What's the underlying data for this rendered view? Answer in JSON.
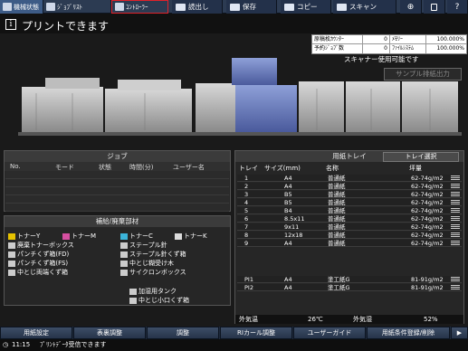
{
  "tabs": [
    {
      "label": "機械状態"
    },
    {
      "label": "ｼﾞｮﾌﾞﾘｽﾄ"
    },
    {
      "label": "ｺﾝﾄﾛｰﾗｰ"
    }
  ],
  "toolbar": {
    "read": "読出し",
    "save": "保存",
    "copy": "コピー",
    "scan": "スキャン"
  },
  "title": "プリントできます",
  "counter": {
    "r1": [
      "原稿枚ｶｳﾝﾀｰ",
      "0",
      "ﾒﾓﾘｰ",
      "100.000%"
    ],
    "r2": [
      "予約ｼﾞｮﾌﾞ数",
      "0",
      "ﾌｧｲﾙｼｽﾃﾑ",
      "100.000%"
    ]
  },
  "scanner_note": "スキャナー使用可能です",
  "sample_button": "サンプル排紙出力",
  "jobs": {
    "title": "ジョブ",
    "columns": [
      "No.",
      "モード",
      "状態",
      "時間(分)",
      "ユーザー名"
    ]
  },
  "supplies": {
    "title": "補給/廃棄部材",
    "items": [
      "トナーY",
      "トナーM",
      "トナーC",
      "トナーK",
      "廃棄トナーボックス",
      "ステープル針",
      "パンチくず箱(FD)",
      "ステープル針くず箱",
      "パンチくず箱(FS)",
      "中とじ糊受け木",
      "中とじ両端くず箱",
      "サイクロンボックス",
      "加湿用タンク",
      "中とじ小口くず箱"
    ]
  },
  "trays": {
    "title": "用紙トレイ",
    "select_button": "トレイ選択",
    "columns": [
      "トレイ",
      "サイズ(mm)",
      "名称",
      "坪量"
    ],
    "rows": [
      [
        "1",
        "A4",
        "普通紙",
        "62-74g/m2"
      ],
      [
        "2",
        "A4",
        "普通紙",
        "62-74g/m2"
      ],
      [
        "3",
        "B5",
        "普通紙",
        "62-74g/m2"
      ],
      [
        "4",
        "B5",
        "普通紙",
        "62-74g/m2"
      ],
      [
        "5",
        "B4",
        "普通紙",
        "62-74g/m2"
      ],
      [
        "6",
        "8.5x11",
        "普通紙",
        "62-74g/m2"
      ],
      [
        "7",
        "9x11",
        "普通紙",
        "62-74g/m2"
      ],
      [
        "8",
        "12x18",
        "普通紙",
        "62-74g/m2"
      ],
      [
        "9",
        "A4",
        "普通紙",
        "62-74g/m2"
      ],
      [
        "PI1",
        "A4",
        "塗工紙G",
        "81-91g/m2"
      ],
      [
        "PI2",
        "A4",
        "塗工紙G",
        "81-91g/m2"
      ]
    ],
    "temp_label": "外気温",
    "temp_value": "26℃",
    "humid_label": "外気湿",
    "humid_value": "52%"
  },
  "bottom_buttons": [
    "用紙設定",
    "表裏調整",
    "調整",
    "RIカール調整",
    "ユーザーガイド",
    "用紙条件登録/削除",
    "▶"
  ],
  "status": {
    "time": "11:15",
    "message": "ﾌﾟﾘﾝﾄﾃﾞｰﾀ受信できます"
  }
}
